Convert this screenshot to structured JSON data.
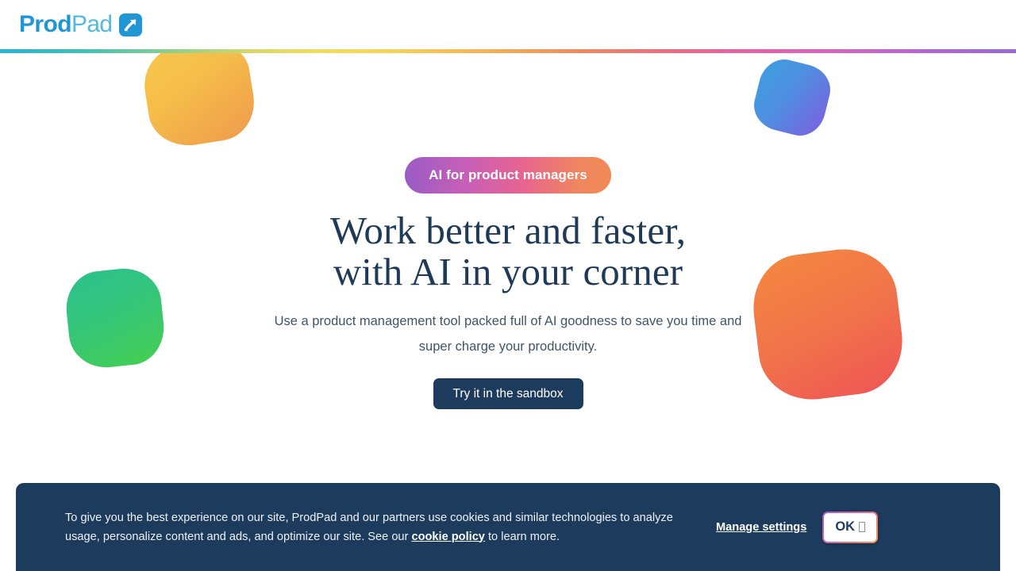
{
  "header": {
    "logo": {
      "prod": "Prod",
      "pad": "Pad",
      "mark_icon": "arrow-up-right-icon"
    }
  },
  "hero": {
    "badge": "AI for product managers",
    "headline_line1": "Work better and faster,",
    "headline_line2": "with AI in your corner",
    "subheading": "Use a product management tool packed full of AI goodness to save you time and super charge your productivity.",
    "cta_label": "Try it in the sandbox",
    "decorations": [
      {
        "name": "yellow-blob",
        "gradient_from": "#f7c84a",
        "gradient_to": "#ef9a4c"
      },
      {
        "name": "purple-blob",
        "gradient_from": "#3c9fe0",
        "gradient_to": "#7d5fe0"
      },
      {
        "name": "green-blob",
        "gradient_from": "#2bc18f",
        "gradient_to": "#45cf50"
      },
      {
        "name": "orange-blob",
        "gradient_from": "#f5883f",
        "gradient_to": "#ef5555"
      }
    ]
  },
  "cookie_banner": {
    "text_part1": "To give you the best experience on our site, ProdPad and our partners use cookies and similar technologies to analyze usage, personalize content and ads, and optimize our site. See our ",
    "link_label": "cookie policy",
    "text_part2": " to learn more.",
    "manage_label": "Manage settings",
    "ok_label": "OK",
    "ok_glyph_icon": "missing-glyph-box"
  },
  "colors": {
    "brand_blue": "#2196d4",
    "brand_blue_light": "#53b9e2",
    "navy": "#1d3b5c",
    "headline": "#1e3a57",
    "body_text": "#3f5568"
  }
}
